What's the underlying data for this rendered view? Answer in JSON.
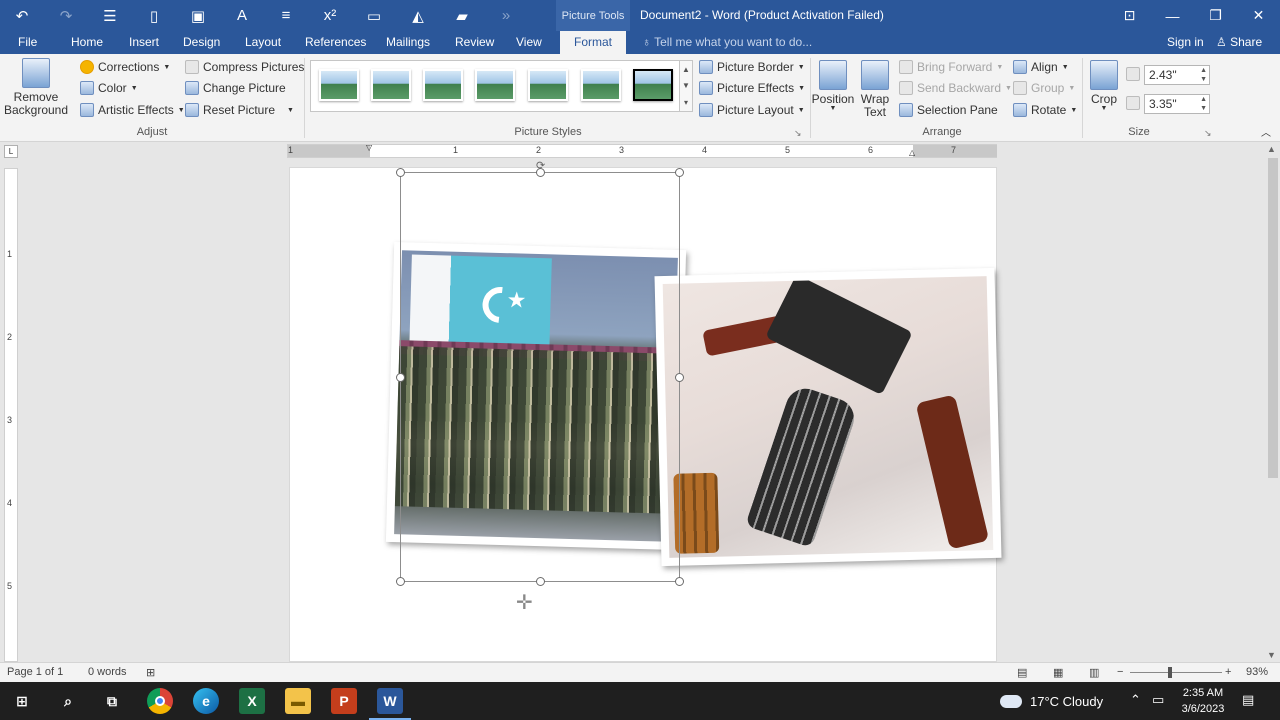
{
  "qat": {
    "undo": "↶",
    "redo": "↷",
    "superscript": "x²"
  },
  "title": {
    "context": "Picture Tools",
    "doc": "Document2 - Word (Product Activation Failed)"
  },
  "tabs": [
    {
      "label": "File"
    },
    {
      "label": "Home"
    },
    {
      "label": "Insert"
    },
    {
      "label": "Design"
    },
    {
      "label": "Layout"
    },
    {
      "label": "References"
    },
    {
      "label": "Mailings"
    },
    {
      "label": "Review"
    },
    {
      "label": "View"
    },
    {
      "label": "Format"
    }
  ],
  "tell_me": "Tell me what you want to do...",
  "sign_in": "Sign in",
  "share": "Share",
  "ribbon": {
    "remove_background_l1": "Remove",
    "remove_background_l2": "Background",
    "corrections": "Corrections",
    "color": "Color",
    "artistic_effects": "Artistic Effects",
    "compress": "Compress Pictures",
    "change": "Change Picture",
    "reset": "Reset Picture",
    "adjust_label": "Adjust",
    "styles_label": "Picture Styles",
    "picture_border": "Picture Border",
    "picture_effects": "Picture Effects",
    "picture_layout": "Picture Layout",
    "position": "Position",
    "wrap_l1": "Wrap",
    "wrap_l2": "Text",
    "bring_forward": "Bring Forward",
    "send_backward": "Send Backward",
    "selection_pane": "Selection Pane",
    "align": "Align",
    "group": "Group",
    "rotate": "Rotate",
    "arrange_label": "Arrange",
    "crop": "Crop",
    "height": "2.43\"",
    "width": "3.35\"",
    "size_label": "Size"
  },
  "ruler": {
    "h": [
      "1",
      "1",
      "2",
      "3",
      "4",
      "5",
      "6",
      "7"
    ],
    "v": [
      "1",
      "2",
      "3",
      "4",
      "5"
    ]
  },
  "status": {
    "page": "Page 1 of 1",
    "words": "0 words",
    "zoom": "93%"
  },
  "taskbar": {
    "excel": "X",
    "powerpoint": "P",
    "word": "W",
    "weather": "17°C  Cloudy",
    "time": "2:35 AM",
    "date": "3/6/2023"
  },
  "colors": {
    "accent": "#2b579a",
    "ribbon": "#f3f3f3"
  }
}
